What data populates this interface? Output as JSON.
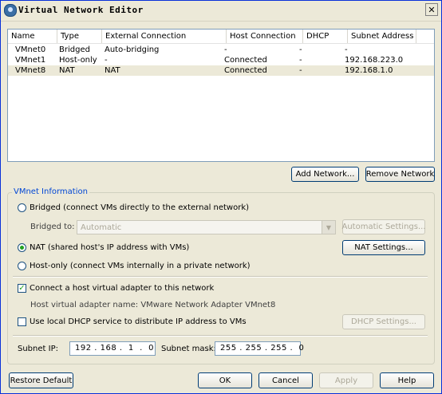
{
  "window": {
    "title": "Virtual Network Editor",
    "close_glyph": "✕"
  },
  "list": {
    "columns": [
      "Name",
      "Type",
      "External Connection",
      "Host Connection",
      "DHCP",
      "Subnet Address"
    ],
    "rows": [
      [
        "VMnet0",
        "Bridged",
        "Auto-bridging",
        "-",
        "-",
        "-"
      ],
      [
        "VMnet1",
        "Host-only",
        "-",
        "Connected",
        "-",
        "192.168.223.0"
      ],
      [
        "VMnet8",
        "NAT",
        "NAT",
        "Connected",
        "-",
        "192.168.1.0"
      ]
    ],
    "selected_row": 2
  },
  "list_buttons": {
    "add_network": "Add Network...",
    "remove_network": "Remove Network"
  },
  "vmnet_info": {
    "legend": "VMnet Information",
    "bridged": {
      "label": "Bridged (connect VMs directly to the external network)",
      "checked": false
    },
    "bridged_to": {
      "label": "Bridged to:",
      "value": "Automatic",
      "arrow": "▼"
    },
    "automatic_settings": "Automatic Settings...",
    "nat": {
      "label": "NAT (shared host's IP address with VMs)",
      "checked": true
    },
    "nat_settings": "NAT Settings...",
    "host_only": {
      "label": "Host-only (connect VMs internally in a private network)",
      "checked": false
    },
    "connect_adapter": {
      "label": "Connect a host virtual adapter to this network",
      "checked": true,
      "mark": "✓"
    },
    "adapter_name": "Host virtual adapter name: VMware Network Adapter VMnet8",
    "use_dhcp": {
      "label": "Use local DHCP service to distribute IP address to VMs",
      "checked": false
    },
    "dhcp_settings": "DHCP Settings...",
    "subnet_ip_label": "Subnet IP:",
    "subnet_ip": "192 . 168 .  1  .  0",
    "subnet_mask_label": "Subnet mask:",
    "subnet_mask": "255 . 255 . 255 .  0"
  },
  "footer": {
    "restore_default": "Restore Default",
    "ok": "OK",
    "cancel": "Cancel",
    "apply": "Apply",
    "help": "Help"
  },
  "colors": {
    "legend": "#0046d5",
    "radio_dot": "#21a121",
    "window_bg": "#ece9d8"
  }
}
